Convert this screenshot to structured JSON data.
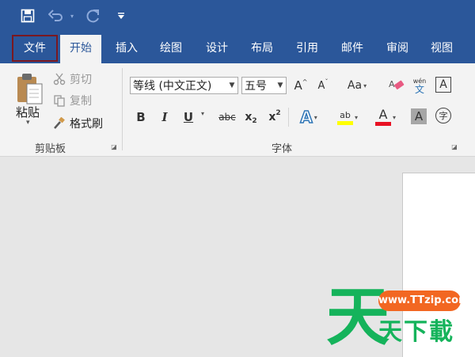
{
  "quick_access": {
    "icons": [
      "save-icon",
      "undo-icon",
      "undo-dropdown-icon",
      "redo-icon",
      "customize-qat-icon"
    ]
  },
  "tabs": [
    {
      "label": "文件",
      "state": "selected-outline"
    },
    {
      "label": "开始",
      "state": "active"
    },
    {
      "label": "插入"
    },
    {
      "label": "绘图"
    },
    {
      "label": "设计"
    },
    {
      "label": "布局"
    },
    {
      "label": "引用"
    },
    {
      "label": "邮件"
    },
    {
      "label": "审阅"
    },
    {
      "label": "视图"
    }
  ],
  "clipboard": {
    "paste_label": "粘贴",
    "cut_label": "剪切",
    "copy_label": "复制",
    "format_painter_label": "格式刷",
    "group_label": "剪贴板"
  },
  "font": {
    "font_name": "等线 (中文正文)",
    "font_size": "五号",
    "group_label": "字体",
    "grow_icon": "A",
    "shrink_icon": "A",
    "case_label": "Aa",
    "bold": "B",
    "italic": "I",
    "underline": "U",
    "strike": "abc",
    "subscript": "x",
    "subscript_mark": "2",
    "superscript": "x",
    "superscript_mark": "2",
    "text_effects": "A",
    "highlight_label": "ab",
    "font_color": "A",
    "char_shading": "A",
    "enclose": "字",
    "phonetic_top": "wén",
    "phonetic_bottom": "文",
    "char_border": "A"
  },
  "colors": {
    "brand": "#2b579a",
    "ribbon_bg": "#f3f3f3",
    "highlight": "#ffff00",
    "font_color": "#e81123",
    "effects": "#2e75b6"
  },
  "watermark": {
    "logo_char": "天",
    "url": "www.TTzip.com",
    "text": "天下載"
  }
}
